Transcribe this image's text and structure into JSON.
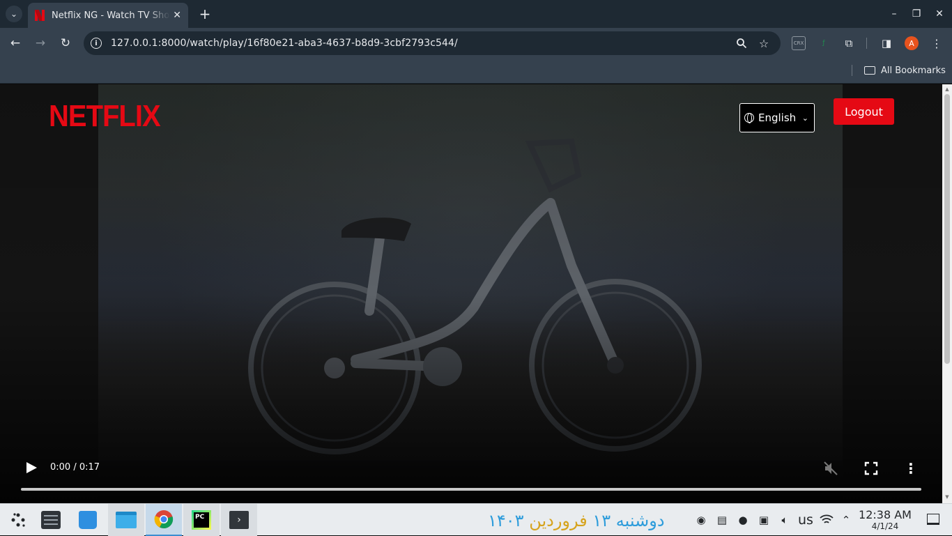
{
  "browser": {
    "tab_title": "Netflix NG - Watch TV Shows Online",
    "url": "127.0.0.1:8000/watch/play/16f80e21-aba3-4637-b8d9-3cbf2793c544/",
    "bookmarks_label": "All Bookmarks",
    "profile_initial": "A",
    "extension_crx": "CRX"
  },
  "page": {
    "logo_text": "NETFLIX",
    "language_selected": "English",
    "logout_label": "Logout",
    "brand_color": "#e50914"
  },
  "video": {
    "time_display": "0:00 / 0:17",
    "current_time": "0:00",
    "duration": "0:17",
    "progress": 0
  },
  "taskbar": {
    "date_persian_weekday": "دوشنبه",
    "date_persian_day": "۱۳",
    "date_persian_month": "فروردین",
    "date_persian_year": "۱۴۰۳",
    "keyboard_layout": "us",
    "time": "12:38 AM",
    "date": "4/1/24"
  }
}
